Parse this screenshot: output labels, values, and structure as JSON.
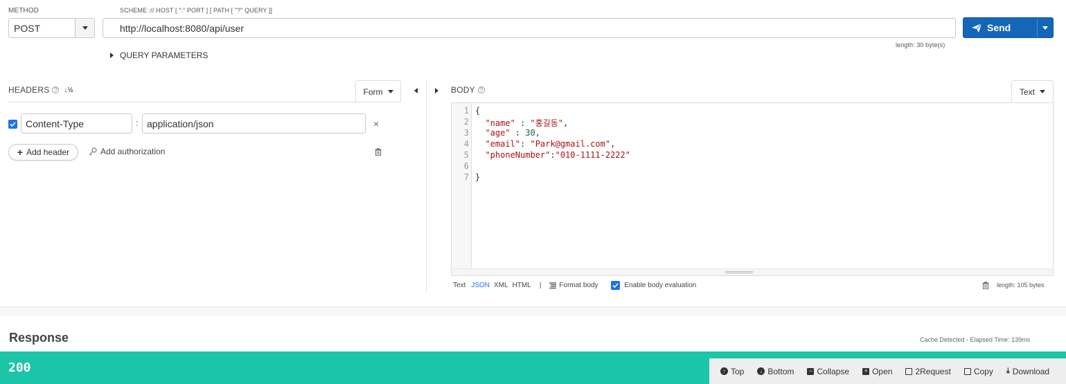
{
  "request": {
    "method_label": "METHOD",
    "method_value": "POST",
    "url_label": "SCHEME :// HOST [ \":\" PORT ] [ PATH [ \"?\" QUERY ]]",
    "url_value": "http://localhost:8080/api/user",
    "url_length": "length: 30 byte(s)",
    "send_label": "Send",
    "query_params_label": "QUERY PARAMETERS"
  },
  "headers": {
    "title": "HEADERS",
    "mode_label": "Form",
    "rows": [
      {
        "name": "Content-Type",
        "separator": ":",
        "value": "application/json",
        "enabled": true
      }
    ],
    "add_header_label": "Add header",
    "add_auth_label": "Add authorization"
  },
  "body": {
    "title": "BODY",
    "mode_label": "Text",
    "line_numbers": [
      "1",
      "2",
      "3",
      "4",
      "5",
      "6",
      "7"
    ],
    "lines": {
      "l1": "{",
      "l2_key": "\"name\"",
      "l2_sep": " : ",
      "l2_val": "\"홍길동\"",
      "l2_end": ",",
      "l3_key": "\"age\"",
      "l3_sep": " : ",
      "l3_val": "30",
      "l3_end": ",",
      "l4_key": "\"email\"",
      "l4_sep": ": ",
      "l4_val": "\"Park@gmail.com\"",
      "l4_end": ",",
      "l5_key": "\"phoneNumber\"",
      "l5_sep": ":",
      "l5_val": "\"010-1111-2222\"",
      "l7": "}"
    },
    "formats": {
      "text": "Text",
      "json": "JSON",
      "xml": "XML",
      "html": "HTML",
      "sep": "|"
    },
    "format_body_label": "Format body",
    "eval_label": "Enable body evaluation",
    "body_length": "length: 105 bytes"
  },
  "response": {
    "title": "Response",
    "cache_info": "Cache Detected - Elapsed Time: 139ms",
    "status_code": "200",
    "toolbar": {
      "top": "Top",
      "bottom": "Bottom",
      "collapse": "Collapse",
      "open": "Open",
      "to_request": "2Request",
      "copy": "Copy",
      "download": "Download"
    }
  },
  "colors": {
    "send_button": "#1466b8",
    "status_bar": "#1bc5a7",
    "json_active": "#1a73e8"
  }
}
